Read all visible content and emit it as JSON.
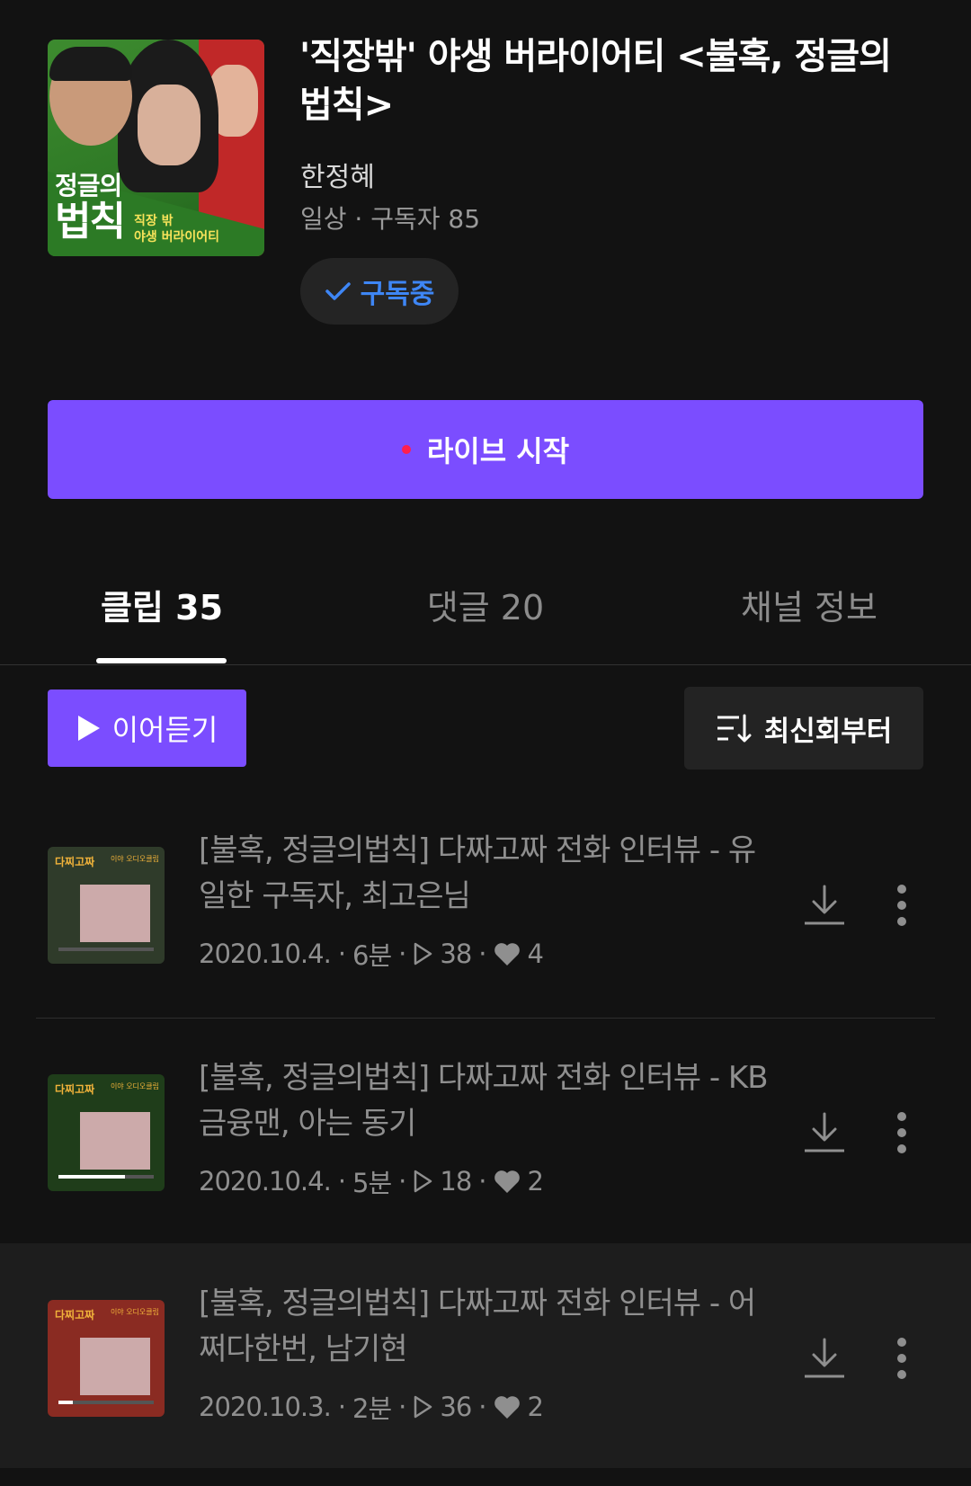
{
  "channel": {
    "cover_text_line1": "정글의",
    "cover_text_line2": "법칙",
    "cover_text_line3": "직장 밖",
    "cover_text_line4": "야생 버라이어티",
    "title": "'직장밖' 야생 버라이어티 <불혹, 정글의 법칙>",
    "author": "한정혜",
    "meta": "일상 · 구독자 85",
    "subscribe_label": "구독중"
  },
  "live_button_label": "라이브 시작",
  "tabs": [
    {
      "label": "클립 35",
      "active": true
    },
    {
      "label": "댓글 20",
      "active": false
    },
    {
      "label": "채널 정보",
      "active": false
    }
  ],
  "play_button_label": "이어듣기",
  "sort_button_label": "최신회부터",
  "colors": {
    "accent": "#7b4dff",
    "subscribe_blue": "#3e86f5",
    "live_dot": "#ff1f4e"
  },
  "clips": [
    {
      "title": "[불혹, 정글의법칙] 다짜고짜 전화 인터뷰 - 유일한 구독자, 최고은님",
      "date": "2020.10.4.",
      "duration": "6분",
      "plays": "38",
      "likes": "4",
      "thumb_label": "다찌고짜",
      "thumb_label2": "이야 오디오클립",
      "thumb_color": "#2f3b2a",
      "progress": 0.0
    },
    {
      "title": "[불혹, 정글의법칙] 다짜고짜 전화 인터뷰 - KB 금융맨, 아는 동기",
      "date": "2020.10.4.",
      "duration": "5분",
      "plays": "18",
      "likes": "2",
      "thumb_label": "다찌고짜",
      "thumb_label2": "이야 오디오클립",
      "thumb_color": "#1f3d1a",
      "progress": 0.7
    },
    {
      "title": "[불혹, 정글의법칙] 다짜고짜 전화 인터뷰 - 어쩌다한번, 남기현",
      "date": "2020.10.3.",
      "duration": "2분",
      "plays": "36",
      "likes": "2",
      "thumb_label": "다찌고짜",
      "thumb_label2": "이야 오디오클립",
      "thumb_color": "#8a2b22",
      "progress": 0.15
    }
  ]
}
